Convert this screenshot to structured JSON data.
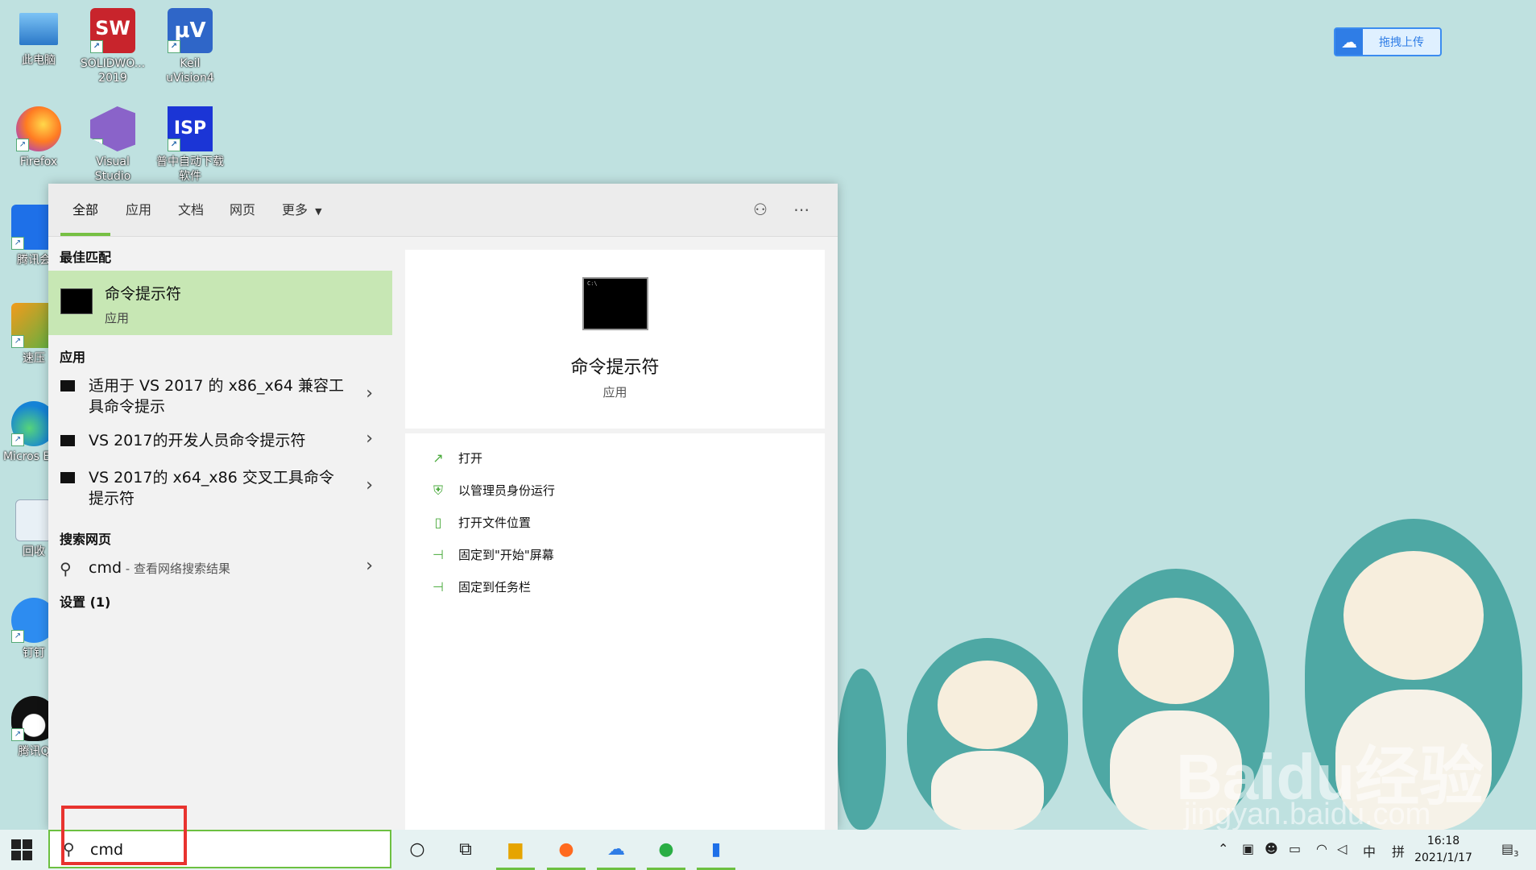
{
  "desktop": {
    "icons": [
      {
        "label": "此电脑",
        "icon": "computer-icon"
      },
      {
        "label": "SOLIDWO... 2019",
        "icon": "solidworks-icon"
      },
      {
        "label": "Keil uVision4",
        "icon": "keil-icon"
      },
      {
        "label": "Firefox",
        "icon": "firefox-icon"
      },
      {
        "label": "Visual Studio 2017",
        "icon": "visual-studio-icon"
      },
      {
        "label": "普中自动下载软件1.86.e...",
        "icon": "isp-icon"
      },
      {
        "label": "腾讯会",
        "icon": "tencent-meeting-icon"
      },
      {
        "label": "速压",
        "icon": "compress-icon"
      },
      {
        "label": "Micros Edg",
        "icon": "edge-icon"
      },
      {
        "label": "回收",
        "icon": "recycle-bin-icon"
      },
      {
        "label": "钉钉",
        "icon": "dingtalk-icon"
      },
      {
        "label": "腾讯Q",
        "icon": "qq-icon"
      }
    ],
    "upload_widget": {
      "label": "拖拽上传"
    },
    "watermark": {
      "line1": "Baidu经验",
      "line2": "jingyan.baidu.com"
    }
  },
  "search_panel": {
    "tabs": [
      "全部",
      "应用",
      "文档",
      "网页",
      "更多"
    ],
    "active_tab": "全部",
    "best_match_title": "最佳匹配",
    "best_match": {
      "name": "命令提示符",
      "type": "应用"
    },
    "apps_title": "应用",
    "apps": [
      {
        "label": "适用于 VS 2017 的 x86_x64 兼容工具命令提示"
      },
      {
        "label": "VS 2017的开发人员命令提示符"
      },
      {
        "label": "VS 2017的 x64_x86 交叉工具命令提示符"
      }
    ],
    "web_title": "搜索网页",
    "web": {
      "query": "cmd",
      "suffix": " - 查看网络搜索结果"
    },
    "settings_title": "设置 (1)",
    "preview": {
      "title": "命令提示符",
      "subtitle": "应用"
    },
    "actions": [
      {
        "label": "打开",
        "icon": "open-icon"
      },
      {
        "label": "以管理员身份运行",
        "icon": "run-as-admin-icon"
      },
      {
        "label": "打开文件位置",
        "icon": "file-location-icon"
      },
      {
        "label": "固定到\"开始\"屏幕",
        "icon": "pin-icon"
      },
      {
        "label": "固定到任务栏",
        "icon": "pin-icon"
      }
    ]
  },
  "taskbar": {
    "search_value": "cmd",
    "ime_mode": "中",
    "ime_layout": "拼",
    "time": "16:18",
    "date": "2021/1/17",
    "notification_count": "3"
  },
  "colors": {
    "accent": "#76c043",
    "best_match_bg": "#c7e7b4",
    "highlight": "#e8332f"
  }
}
